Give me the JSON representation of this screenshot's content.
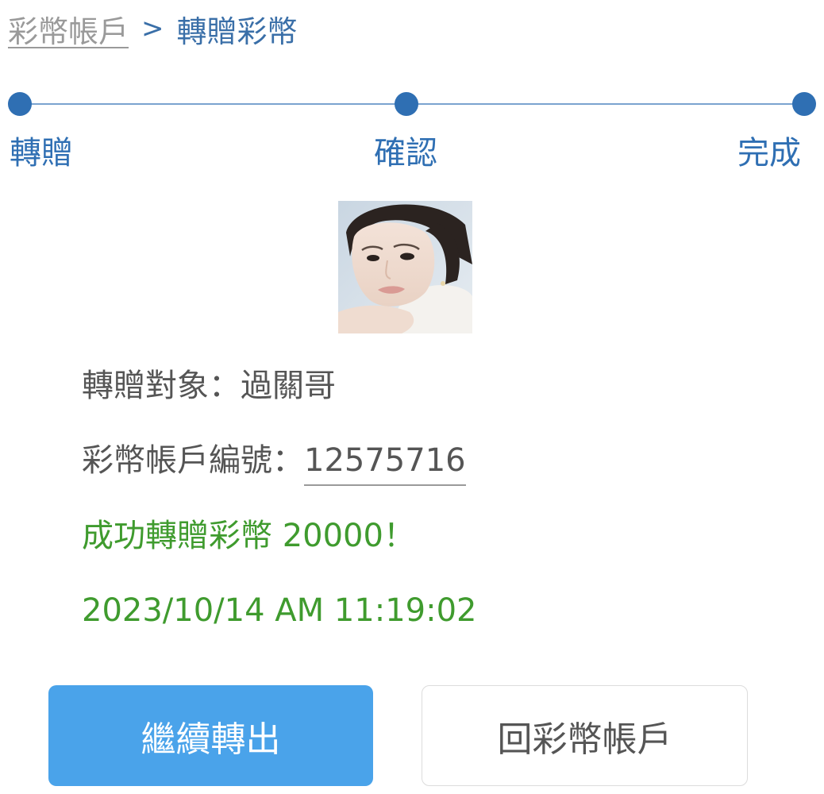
{
  "breadcrumb": {
    "parent": "彩幣帳戶",
    "separator": ">",
    "current": "轉贈彩幣"
  },
  "stepper": {
    "steps": [
      {
        "label": "轉贈"
      },
      {
        "label": "確認"
      },
      {
        "label": "完成"
      }
    ],
    "active_step": 3,
    "color": "#2f6fb3"
  },
  "recipient": {
    "label": "轉贈對象：",
    "name": "過關哥"
  },
  "account": {
    "label": "彩幣帳戶編號：",
    "number": "12575716"
  },
  "result": {
    "message": "成功轉贈彩幣 20000！",
    "timestamp": "2023/10/14 AM 11:19:02",
    "color": "#3f9b2e"
  },
  "buttons": {
    "continue_label": "繼續轉出",
    "back_label": "回彩幣帳戶",
    "primary_color": "#4aa3ea"
  }
}
